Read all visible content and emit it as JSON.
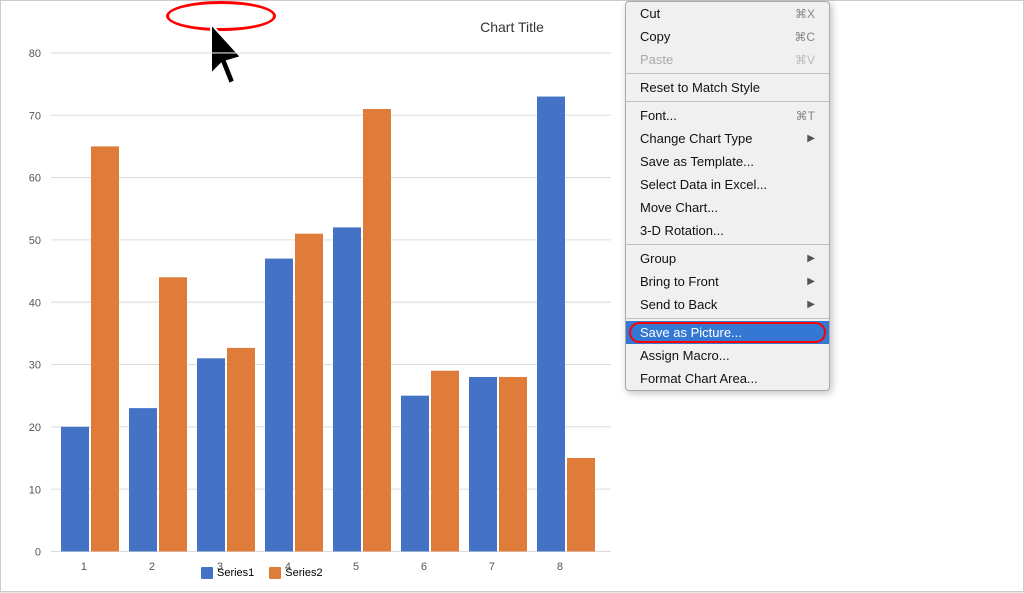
{
  "chart": {
    "title": "Chart Title",
    "xAxisLabels": [
      "1",
      "2",
      "3",
      "4",
      "5",
      "6",
      "7",
      "8"
    ],
    "yAxisLabels": [
      "0",
      "10",
      "20",
      "30",
      "40",
      "50",
      "60",
      "70",
      "80"
    ],
    "series1Color": "#4472C4",
    "series2Color": "#E07C39",
    "series1Label": "Series1",
    "series2Label": "Series2",
    "bars": [
      {
        "s1": 20,
        "s2": 65
      },
      {
        "s1": 23,
        "s2": 44
      },
      {
        "s1": 31,
        "s2": 33
      },
      {
        "s1": 47,
        "s2": 51
      },
      {
        "s1": 52,
        "s2": 71
      },
      {
        "s1": 25,
        "s2": 29
      },
      {
        "s1": 28,
        "s2": 28
      },
      {
        "s1": 73,
        "s2": 15
      }
    ]
  },
  "contextMenu": {
    "items": [
      {
        "label": "Cut",
        "shortcut": "⌘X",
        "separator": false,
        "type": "normal"
      },
      {
        "label": "Copy",
        "shortcut": "⌘C",
        "separator": false,
        "type": "normal"
      },
      {
        "label": "Paste",
        "shortcut": "⌘V",
        "separator": true,
        "type": "normal",
        "disabled": true
      },
      {
        "label": "Reset to Match Style",
        "shortcut": "",
        "separator": true,
        "type": "normal"
      },
      {
        "label": "Font...",
        "shortcut": "⌘T",
        "separator": false,
        "type": "normal"
      },
      {
        "label": "Change Chart Type",
        "shortcut": "",
        "separator": false,
        "type": "submenu"
      },
      {
        "label": "Save as Template...",
        "shortcut": "",
        "separator": false,
        "type": "normal"
      },
      {
        "label": "Select Data in Excel...",
        "shortcut": "",
        "separator": false,
        "type": "normal"
      },
      {
        "label": "Move Chart...",
        "shortcut": "",
        "separator": false,
        "type": "normal"
      },
      {
        "label": "3-D Rotation...",
        "shortcut": "",
        "separator": true,
        "type": "normal"
      },
      {
        "label": "Group",
        "shortcut": "",
        "separator": false,
        "type": "submenu"
      },
      {
        "label": "Bring to Front",
        "shortcut": "",
        "separator": false,
        "type": "submenu"
      },
      {
        "label": "Send to Back",
        "shortcut": "",
        "separator": true,
        "type": "submenu"
      },
      {
        "label": "Save as Picture...",
        "shortcut": "",
        "separator": false,
        "type": "highlighted"
      },
      {
        "label": "Assign Macro...",
        "shortcut": "",
        "separator": false,
        "type": "normal"
      },
      {
        "label": "Format Chart Area...",
        "shortcut": "",
        "separator": false,
        "type": "normal"
      }
    ]
  }
}
